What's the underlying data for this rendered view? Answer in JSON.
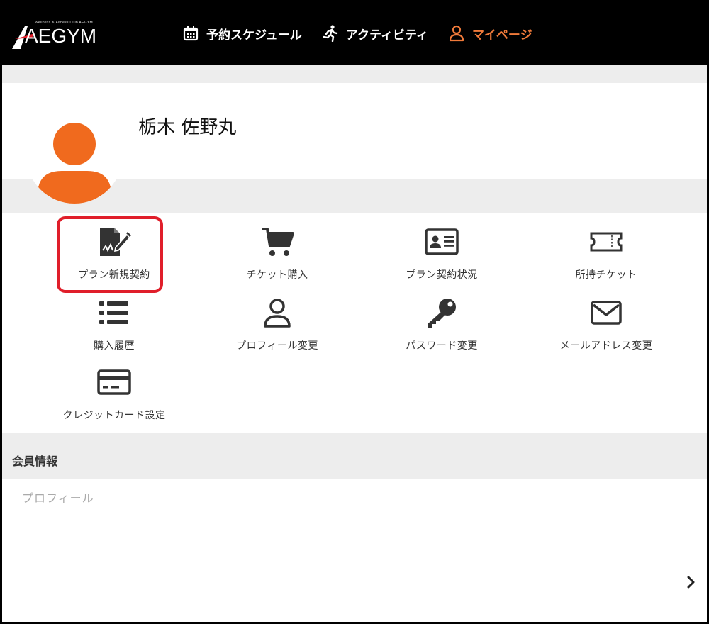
{
  "header": {
    "logo_tagline": "Wellness & Fitness Club AEGYM",
    "logo_text": "AEGYM",
    "nav": [
      {
        "label": "予約スケジュール",
        "icon": "calendar-icon"
      },
      {
        "label": "アクティビティ",
        "icon": "running-icon"
      },
      {
        "label": "マイページ",
        "icon": "user-icon",
        "active": true
      }
    ]
  },
  "profile": {
    "user_name": "栃木 佐野丸",
    "avatar_color": "#f06a1e"
  },
  "menu": {
    "items": [
      {
        "label": "プラン新規契約",
        "icon": "contract-sign-icon"
      },
      {
        "label": "チケット購入",
        "icon": "cart-icon"
      },
      {
        "label": "プラン契約状況",
        "icon": "id-card-icon"
      },
      {
        "label": "所持チケット",
        "icon": "ticket-icon"
      },
      {
        "label": "購入履歴",
        "icon": "list-icon"
      },
      {
        "label": "プロフィール変更",
        "icon": "user-outline-icon"
      },
      {
        "label": "パスワード変更",
        "icon": "key-icon"
      },
      {
        "label": "メールアドレス変更",
        "icon": "envelope-icon"
      },
      {
        "label": "クレジットカード設定",
        "icon": "credit-card-icon"
      }
    ]
  },
  "member_info": {
    "title": "会員情報",
    "profile_label": "プロフィール"
  },
  "colors": {
    "accent": "#f07a3a",
    "highlight": "#e01e2a"
  }
}
